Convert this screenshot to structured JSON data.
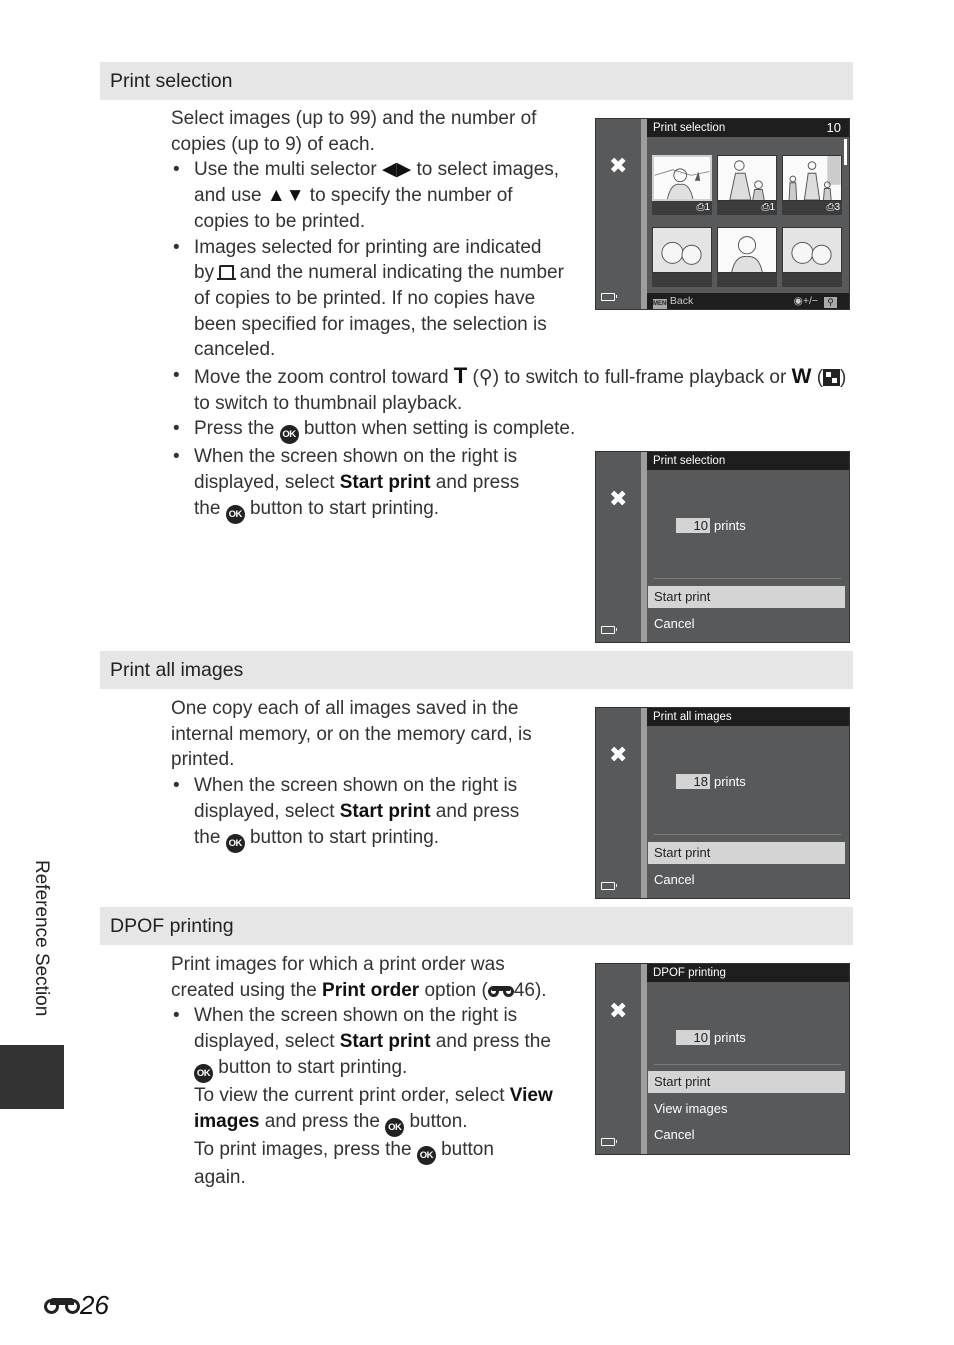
{
  "sections": [
    {
      "heading": "Print selection",
      "intro": "Select images (up to 99) and the number of copies (up to 9) of each.",
      "bullets": {
        "b1_a": "Use the multi selector ",
        "b1_lr": "◀▶",
        "b1_b": " to select images, and use ",
        "b1_ud": "▲▼",
        "b1_c": " to specify the number of copies to be printed.",
        "b2_a": "Images selected for printing are indicated by ",
        "b2_b": " and the numeral indicating the number of copies to be printed. If no copies have been specified for images, the selection is canceled.",
        "b3_a": "Move the zoom control toward ",
        "b3_T": "T",
        "b3_b": " (",
        "b3_q": "🔍",
        "b3_c": ") to switch to full-frame playback or ",
        "b3_W": "W",
        "b3_d": " (",
        "b3_e": ") to switch to thumbnail playback.",
        "b4_a": "Press the ",
        "b4_b": " button when setting is complete.",
        "b5_a": "When the screen shown on the right is displayed, select ",
        "b5_bold": "Start print",
        "b5_b": " and press the ",
        "b5_c": " button to start printing."
      },
      "screen1": {
        "title": "Print selection",
        "count": "10",
        "thumb_copies": [
          "1",
          "1",
          "3",
          "",
          "",
          ""
        ],
        "back_label": "Back",
        "menu_icon": "MENU",
        "adjust_label": "+/−",
        "zoom_icon": "🔍"
      },
      "screen2": {
        "title": "Print selection",
        "prints_value": "10",
        "prints_label": "prints",
        "menu": [
          "Start print",
          "Cancel"
        ],
        "selected": "Start print"
      }
    },
    {
      "heading": "Print all images",
      "intro": "One copy each of all images saved in the internal memory, or on the memory card, is printed.",
      "b1_a": "When the screen shown on the right is displayed, select ",
      "b1_bold": "Start print",
      "b1_b": " and press the ",
      "b1_c": " button to start printing.",
      "screen": {
        "title": "Print all images",
        "prints_value": "18",
        "prints_label": "prints",
        "menu": [
          "Start print",
          "Cancel"
        ],
        "selected": "Start print"
      }
    },
    {
      "heading": "DPOF printing",
      "intro_a": "Print images for which a print order was created using the ",
      "intro_bold": "Print order",
      "intro_b": " option (",
      "intro_ref": "46",
      "intro_c": ").",
      "b1_a": "When the screen shown on the right is displayed, select ",
      "b1_bold": "Start print",
      "b1_b": " and press the ",
      "b1_c": " button to start printing.",
      "b1_d": "To view the current print order, select ",
      "b1_bold2": "View images",
      "b1_e": " and press the ",
      "b1_f": " button.",
      "b1_g": "To print images, press the ",
      "b1_h": " button again.",
      "screen": {
        "title": "DPOF printing",
        "prints_value": "10",
        "prints_label": "prints",
        "menu": [
          "Start print",
          "View images",
          "Cancel"
        ],
        "selected": "Start print"
      }
    }
  ],
  "ok_label": "OK",
  "side_tab": "Reference Section",
  "page_number": "26"
}
